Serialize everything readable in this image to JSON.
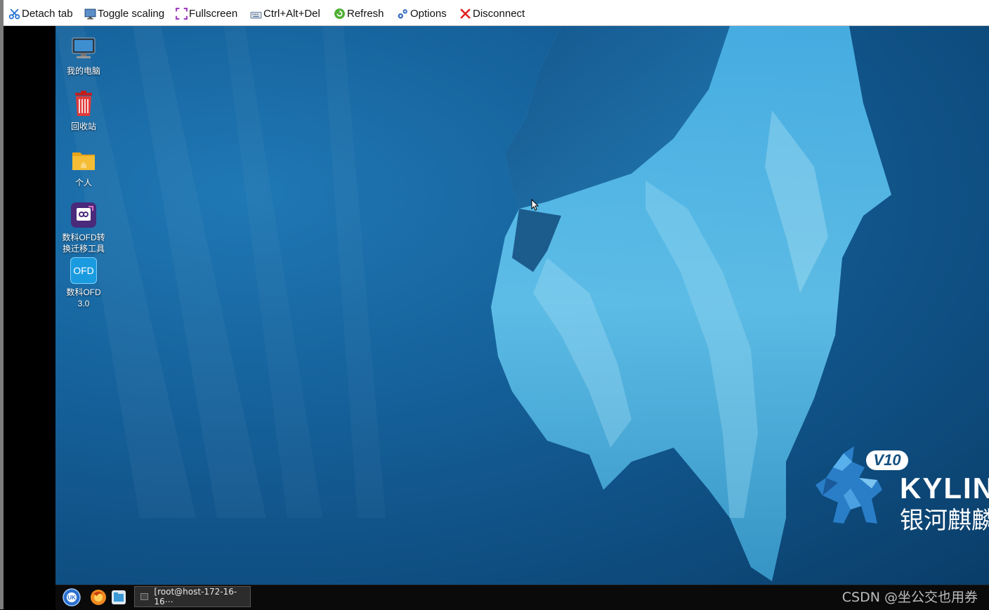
{
  "toolbar": {
    "items": [
      {
        "label": "Detach tab",
        "icon": "scissors-icon"
      },
      {
        "label": "Toggle scaling",
        "icon": "monitor-icon"
      },
      {
        "label": "Fullscreen",
        "icon": "fullscreen-icon"
      },
      {
        "label": "Ctrl+Alt+Del",
        "icon": "keyboard-icon"
      },
      {
        "label": "Refresh",
        "icon": "refresh-icon"
      },
      {
        "label": "Options",
        "icon": "gears-icon"
      },
      {
        "label": "Disconnect",
        "icon": "close-x-icon"
      }
    ]
  },
  "desktop": {
    "icons": [
      {
        "label": "我的电脑",
        "icon": "computer-icon"
      },
      {
        "label": "回收站",
        "icon": "trash-icon"
      },
      {
        "label": "个人",
        "icon": "folder-icon"
      },
      {
        "label_line1": "数科OFD转",
        "label_line2": "换迁移工具",
        "icon": "ofd-migration-icon"
      },
      {
        "label_line1": "数科OFD",
        "label_line2": "3.0",
        "icon": "ofd-app-icon",
        "icon_text": "OFD"
      }
    ],
    "logo": {
      "version": "V10",
      "brand": "KYLIN",
      "brand_cn": "银河麒麟"
    }
  },
  "taskbar": {
    "window_title": "[root@host-172-16-16⋯",
    "watermark": "CSDN @坐公交也用券"
  },
  "colors": {
    "desktop_blue": "#15609a",
    "taskbar": "#0a0a0a",
    "ofd_blue": "#1a9be0",
    "ofd_purple": "#4a2a7a",
    "trash_red": "#d83030",
    "folder_yellow": "#f2b52a"
  }
}
